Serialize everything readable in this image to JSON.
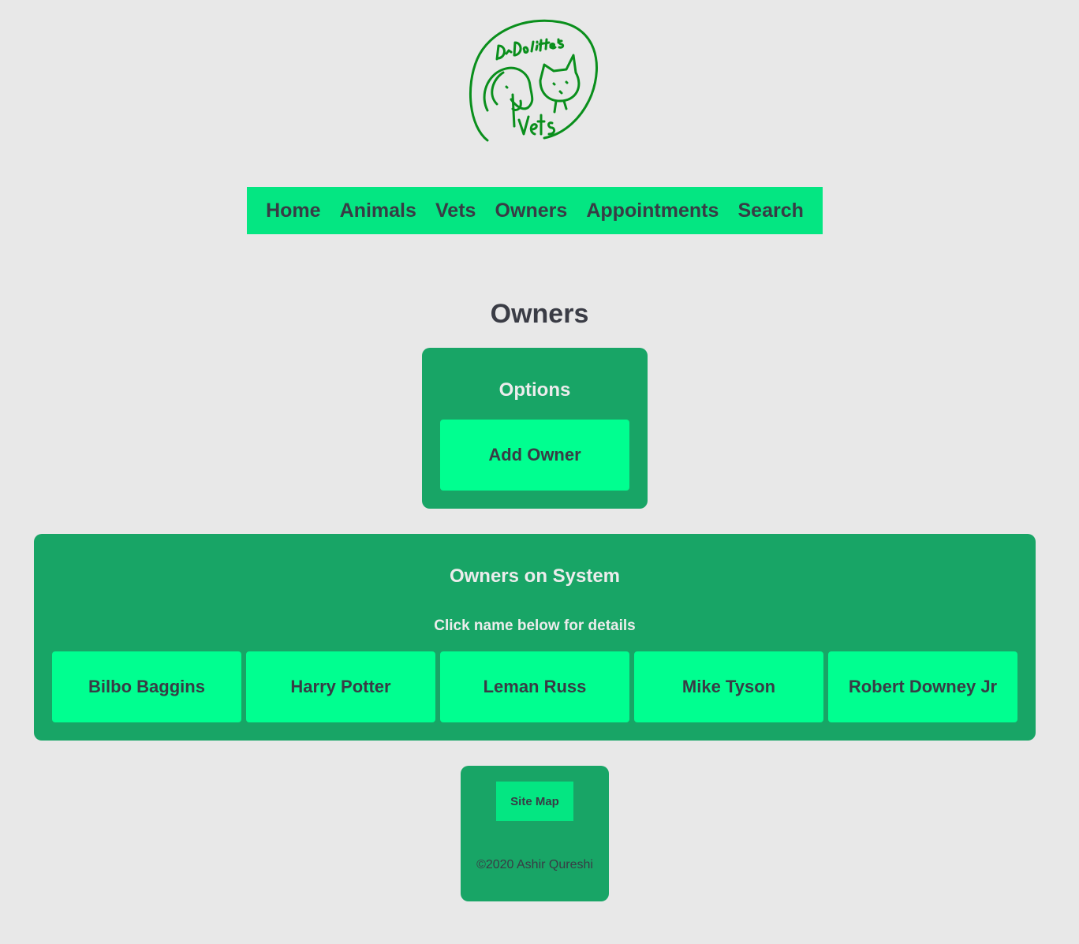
{
  "logo": {
    "text_top": "Dr Dolittle's",
    "text_bottom": "Vets",
    "color": "#0a8f1c"
  },
  "nav": {
    "items": [
      {
        "label": "Home"
      },
      {
        "label": "Animals"
      },
      {
        "label": "Vets"
      },
      {
        "label": "Owners"
      },
      {
        "label": "Appointments"
      },
      {
        "label": "Search"
      }
    ]
  },
  "page": {
    "title": "Owners"
  },
  "options": {
    "title": "Options",
    "add_owner_label": "Add Owner"
  },
  "owners_panel": {
    "title": "Owners on System",
    "hint": "Click name below for details",
    "owners": [
      {
        "name": "Bilbo Baggins"
      },
      {
        "name": "Harry Potter"
      },
      {
        "name": "Leman Russ"
      },
      {
        "name": "Mike Tyson"
      },
      {
        "name": "Robert Downey Jr"
      }
    ]
  },
  "footer": {
    "site_map_label": "Site Map",
    "copyright": "©2020 Ashir Qureshi"
  },
  "colors": {
    "background": "#e8e8e8",
    "nav": "#04e682",
    "panel": "#18a566",
    "button": "#00ff90",
    "text_dark": "#383c45",
    "text_light": "#ececec"
  }
}
